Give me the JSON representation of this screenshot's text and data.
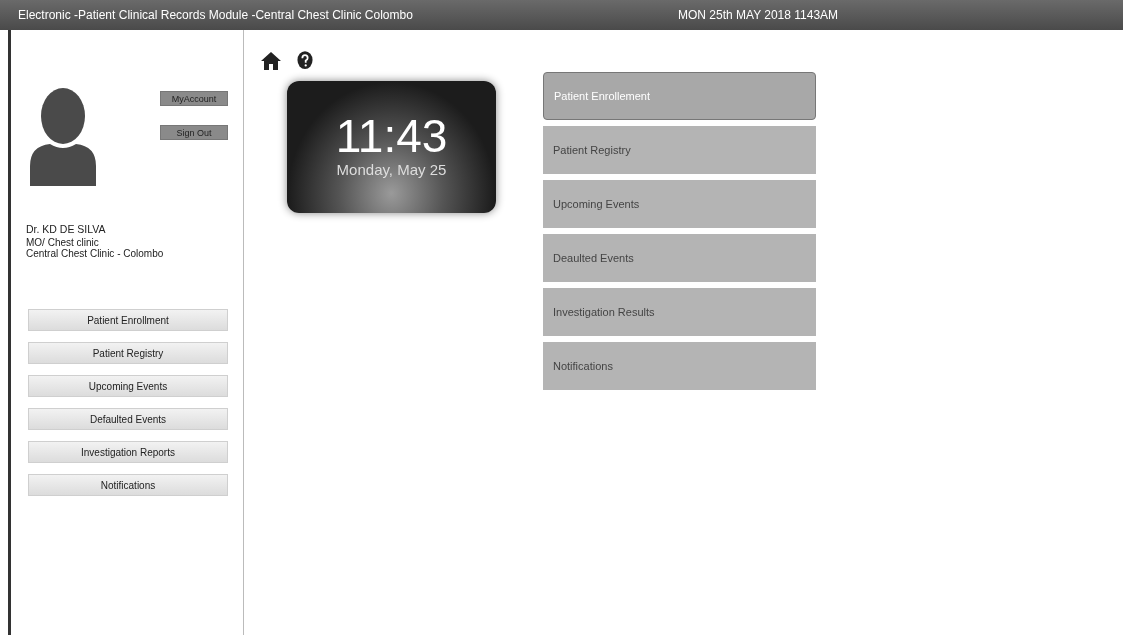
{
  "header": {
    "title": "Electronic -Patient Clinical Records Module -Central Chest Clinic Colombo",
    "datetime": "MON 25th MAY 2018 1143AM"
  },
  "account": {
    "buttons": [
      "MyAccount",
      "Sign Out"
    ],
    "name": "Dr. KD DE SILVA",
    "role": "MO/ Chest clinic",
    "clinic": "Central Chest Clinic - Colombo"
  },
  "sidebar": {
    "items": [
      "Patient Enrollment",
      "Patient Registry",
      "Upcoming Events",
      "Defaulted Events",
      "Investigation Reports",
      "Notifications"
    ]
  },
  "clock": {
    "time": "11:43",
    "date": "Monday, May 25"
  },
  "menu": {
    "items": [
      {
        "label": "Patient Enrollement",
        "selected": true
      },
      {
        "label": "Patient Registry",
        "selected": false
      },
      {
        "label": "Upcoming Events",
        "selected": false
      },
      {
        "label": "Deaulted Events",
        "selected": false
      },
      {
        "label": "Investigation Results",
        "selected": false
      },
      {
        "label": "Notifications",
        "selected": false
      }
    ]
  }
}
